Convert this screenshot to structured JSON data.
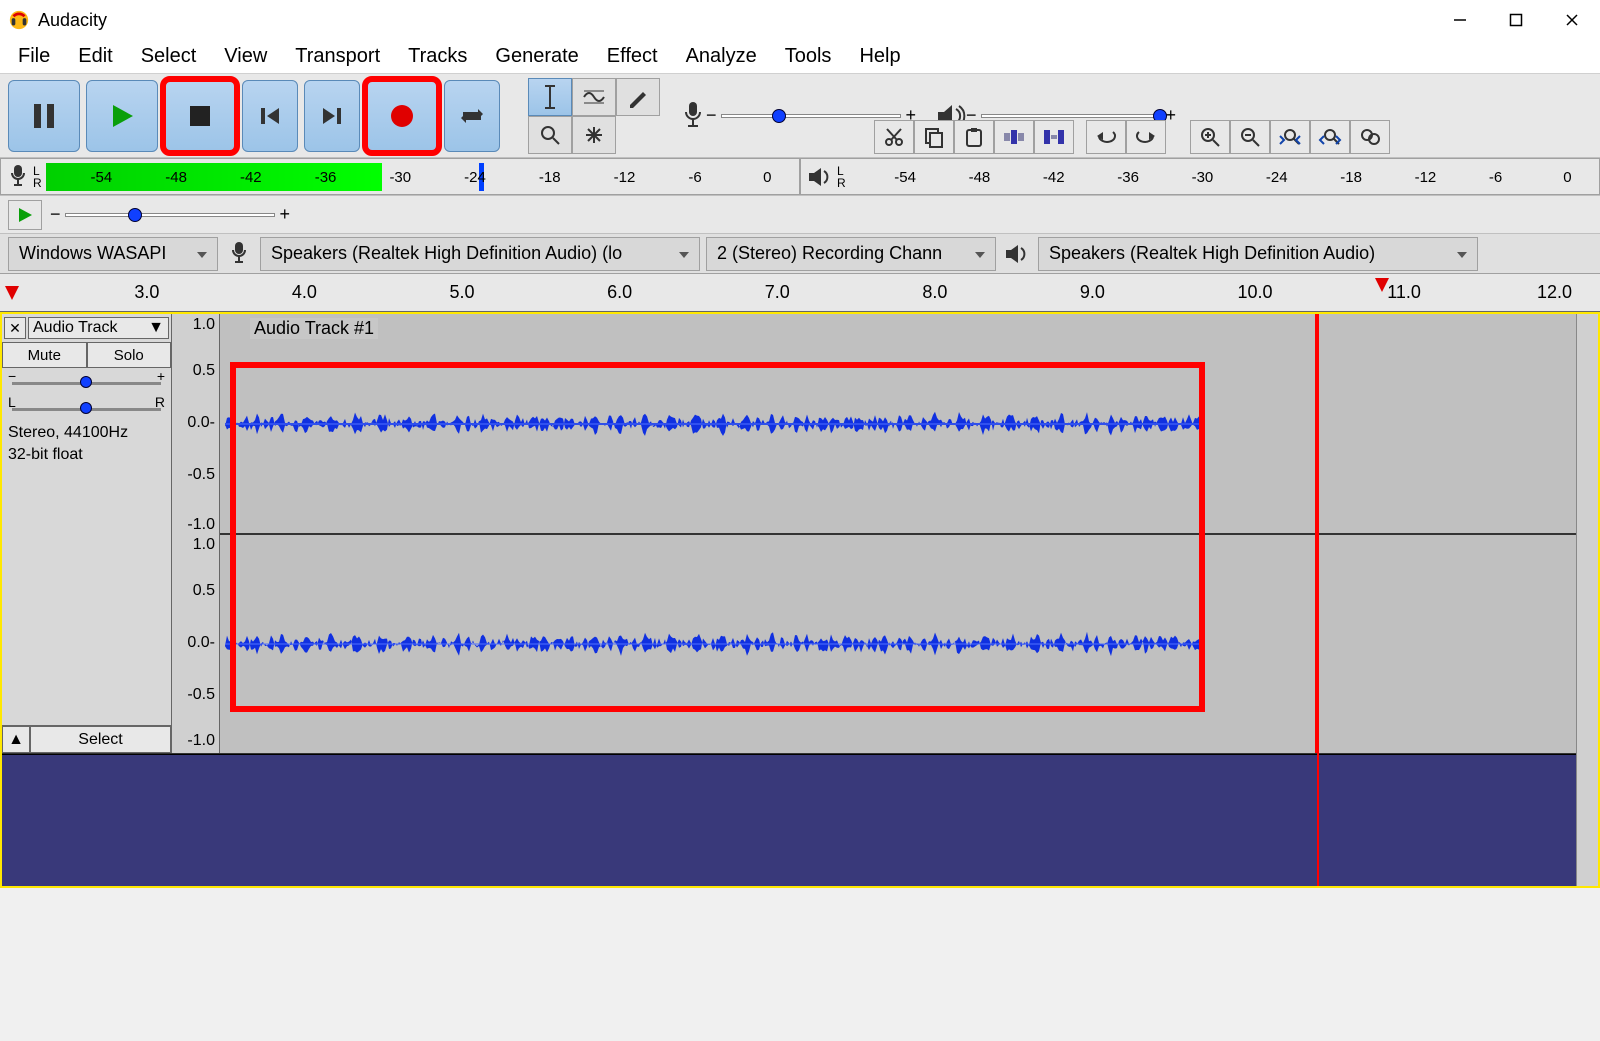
{
  "app": {
    "title": "Audacity"
  },
  "menu": {
    "items": [
      "File",
      "Edit",
      "Select",
      "View",
      "Transport",
      "Tracks",
      "Generate",
      "Effect",
      "Analyze",
      "Tools",
      "Help"
    ]
  },
  "meters": {
    "rec": {
      "ticks": [
        "-54",
        "-48",
        "-42",
        "-36",
        "-30",
        "-24",
        "-18",
        "-12",
        "-6",
        "0"
      ],
      "fill_pct": 45
    },
    "play": {
      "ticks": [
        "-54",
        "-48",
        "-42",
        "-36",
        "-30",
        "-24",
        "-18",
        "-12",
        "-6",
        "0"
      ]
    }
  },
  "devices": {
    "host": "Windows WASAPI",
    "rec_dev": "Speakers (Realtek High Definition Audio) (lo",
    "rec_ch": "2 (Stereo) Recording Chann",
    "play_dev": "Speakers (Realtek High Definition Audio)"
  },
  "timeline": {
    "labels": [
      "3.0",
      "4.0",
      "5.0",
      "6.0",
      "7.0",
      "8.0",
      "9.0",
      "10.0",
      "11.0",
      "12.0"
    ],
    "playhead_sec": 11.0
  },
  "track": {
    "menu_label": "Audio Track",
    "mute": "Mute",
    "solo": "Solo",
    "pan_l": "L",
    "pan_r": "R",
    "info1": "Stereo, 44100Hz",
    "info2": "32-bit float",
    "select": "Select",
    "clip_name": "Audio Track #1",
    "amp_ticks": [
      "1.0",
      "0.5",
      "0.0-",
      "-0.5",
      "-1.0",
      "1.0",
      "0.5",
      "0.0-",
      "-0.5",
      "-1.0"
    ]
  }
}
